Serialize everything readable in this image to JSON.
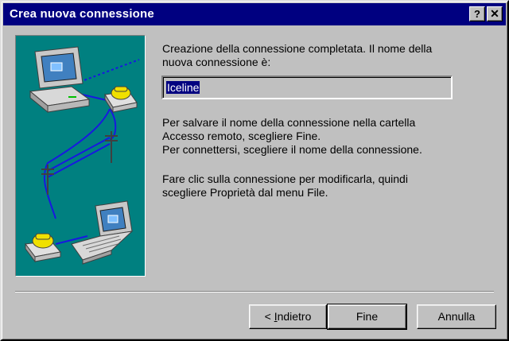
{
  "window": {
    "title": "Crea nuova connessione"
  },
  "titlebar_buttons": {
    "help": "?",
    "close": "✕"
  },
  "content": {
    "intro_lines": [
      "Creazione della connessione completata. Il nome della",
      "nuova connessione è:"
    ],
    "connection_name": "Iceline",
    "save_lines": [
      "Per salvare il nome della connessione nella cartella",
      "Accesso remoto, scegliere Fine.",
      "Per connettersi, scegliere il nome della connessione."
    ],
    "edit_lines": [
      "Fare clic sulla connessione per modificarla, quindi",
      "scegliere Proprietà dal menu File."
    ]
  },
  "buttons": {
    "back_prefix": "< ",
    "back_mnemonic": "I",
    "back_rest": "ndietro",
    "finish": "Fine",
    "cancel": "Annulla"
  },
  "illustration": {
    "icons": [
      "desktop-computer-icon",
      "telephone-icon",
      "utility-pole-icon",
      "laptop-icon"
    ]
  }
}
